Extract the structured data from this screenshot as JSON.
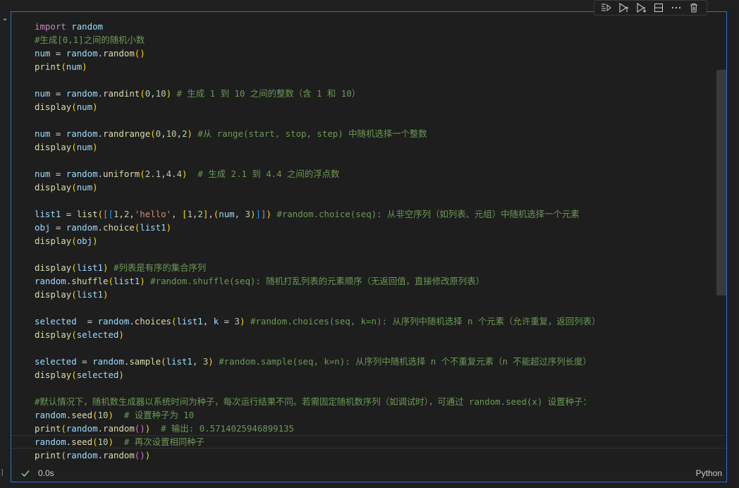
{
  "cell": {
    "language": "Python",
    "execution_time": "0.0s",
    "status": "success",
    "left_edge_glyph": "]",
    "code_lines": [
      [
        [
          "kw",
          "import"
        ],
        [
          "op",
          " "
        ],
        [
          "var",
          "random"
        ]
      ],
      [
        [
          "cmt",
          "#生成[0,1]之间的随机小数"
        ]
      ],
      [
        [
          "var",
          "num"
        ],
        [
          "op",
          " = "
        ],
        [
          "var",
          "random"
        ],
        [
          "op",
          "."
        ],
        [
          "fn",
          "random"
        ],
        [
          "p1",
          "()"
        ]
      ],
      [
        [
          "fn",
          "print"
        ],
        [
          "p1",
          "("
        ],
        [
          "var",
          "num"
        ],
        [
          "p1",
          ")"
        ]
      ],
      [],
      [
        [
          "var",
          "num"
        ],
        [
          "op",
          " = "
        ],
        [
          "var",
          "random"
        ],
        [
          "op",
          "."
        ],
        [
          "fn",
          "randint"
        ],
        [
          "p1",
          "("
        ],
        [
          "num",
          "0"
        ],
        [
          "op",
          ","
        ],
        [
          "num",
          "10"
        ],
        [
          "p1",
          ")"
        ],
        [
          "op",
          " "
        ],
        [
          "cmt",
          "# 生成 1 到 10 之间的整数（含 1 和 10）"
        ]
      ],
      [
        [
          "fn",
          "display"
        ],
        [
          "p1",
          "("
        ],
        [
          "var",
          "num"
        ],
        [
          "p1",
          ")"
        ]
      ],
      [],
      [
        [
          "var",
          "num"
        ],
        [
          "op",
          " = "
        ],
        [
          "var",
          "random"
        ],
        [
          "op",
          "."
        ],
        [
          "fn",
          "randrange"
        ],
        [
          "p1",
          "("
        ],
        [
          "num",
          "0"
        ],
        [
          "op",
          ","
        ],
        [
          "num",
          "10"
        ],
        [
          "op",
          ","
        ],
        [
          "num",
          "2"
        ],
        [
          "p1",
          ")"
        ],
        [
          "op",
          " "
        ],
        [
          "cmt",
          "#从 range(start, stop, step) 中随机选择一个整数"
        ]
      ],
      [
        [
          "fn",
          "display"
        ],
        [
          "p1",
          "("
        ],
        [
          "var",
          "num"
        ],
        [
          "p1",
          ")"
        ]
      ],
      [],
      [
        [
          "var",
          "num"
        ],
        [
          "op",
          " = "
        ],
        [
          "var",
          "random"
        ],
        [
          "op",
          "."
        ],
        [
          "fn",
          "uniform"
        ],
        [
          "p1",
          "("
        ],
        [
          "num",
          "2.1"
        ],
        [
          "op",
          ","
        ],
        [
          "num",
          "4.4"
        ],
        [
          "p1",
          ")"
        ],
        [
          "op",
          "  "
        ],
        [
          "cmt",
          "# 生成 2.1 到 4.4 之间的浮点数"
        ]
      ],
      [
        [
          "fn",
          "display"
        ],
        [
          "p1",
          "("
        ],
        [
          "var",
          "num"
        ],
        [
          "p1",
          ")"
        ]
      ],
      [],
      [
        [
          "var",
          "list1"
        ],
        [
          "op",
          " = "
        ],
        [
          "fn",
          "list"
        ],
        [
          "p1",
          "("
        ],
        [
          "p2",
          "["
        ],
        [
          "p3",
          "["
        ],
        [
          "num",
          "1"
        ],
        [
          "op",
          ","
        ],
        [
          "num",
          "2"
        ],
        [
          "op",
          ","
        ],
        [
          "str",
          "'hello'"
        ],
        [
          "op",
          ", "
        ],
        [
          "p1",
          "["
        ],
        [
          "num",
          "1"
        ],
        [
          "op",
          ","
        ],
        [
          "num",
          "2"
        ],
        [
          "p1",
          "]"
        ],
        [
          "op",
          ","
        ],
        [
          "p1",
          "("
        ],
        [
          "var",
          "num"
        ],
        [
          "op",
          ", "
        ],
        [
          "num",
          "3"
        ],
        [
          "p1",
          ")"
        ],
        [
          "p3",
          "]"
        ],
        [
          "p2",
          "]"
        ],
        [
          "p1",
          ")"
        ],
        [
          "op",
          " "
        ],
        [
          "cmt",
          "#random.choice(seq): 从非空序列（如列表、元组）中随机选择一个元素"
        ]
      ],
      [
        [
          "var",
          "obj"
        ],
        [
          "op",
          " = "
        ],
        [
          "var",
          "random"
        ],
        [
          "op",
          "."
        ],
        [
          "fn",
          "choice"
        ],
        [
          "p1",
          "("
        ],
        [
          "var",
          "list1"
        ],
        [
          "p1",
          ")"
        ]
      ],
      [
        [
          "fn",
          "display"
        ],
        [
          "p1",
          "("
        ],
        [
          "var",
          "obj"
        ],
        [
          "p1",
          ")"
        ]
      ],
      [],
      [
        [
          "fn",
          "display"
        ],
        [
          "p1",
          "("
        ],
        [
          "var",
          "list1"
        ],
        [
          "p1",
          ")"
        ],
        [
          "op",
          " "
        ],
        [
          "cmt",
          "#列表是有序的集合序列"
        ]
      ],
      [
        [
          "var",
          "random"
        ],
        [
          "op",
          "."
        ],
        [
          "fn",
          "shuffle"
        ],
        [
          "p1",
          "("
        ],
        [
          "var",
          "list1"
        ],
        [
          "p1",
          ")"
        ],
        [
          "op",
          " "
        ],
        [
          "cmt",
          "#random.shuffle(seq): 随机打乱列表的元素顺序（无返回值，直接修改原列表）"
        ]
      ],
      [
        [
          "fn",
          "display"
        ],
        [
          "p1",
          "("
        ],
        [
          "var",
          "list1"
        ],
        [
          "p1",
          ")"
        ]
      ],
      [],
      [
        [
          "var",
          "selected"
        ],
        [
          "op",
          "  = "
        ],
        [
          "var",
          "random"
        ],
        [
          "op",
          "."
        ],
        [
          "fn",
          "choices"
        ],
        [
          "p1",
          "("
        ],
        [
          "var",
          "list1"
        ],
        [
          "op",
          ", "
        ],
        [
          "var",
          "k"
        ],
        [
          "op",
          " = "
        ],
        [
          "num",
          "3"
        ],
        [
          "p1",
          ")"
        ],
        [
          "op",
          " "
        ],
        [
          "cmt",
          "#random.choices(seq, k=n): 从序列中随机选择 n 个元素（允许重复，返回列表）"
        ]
      ],
      [
        [
          "fn",
          "display"
        ],
        [
          "p1",
          "("
        ],
        [
          "var",
          "selected"
        ],
        [
          "p1",
          ")"
        ]
      ],
      [],
      [
        [
          "var",
          "selected"
        ],
        [
          "op",
          " = "
        ],
        [
          "var",
          "random"
        ],
        [
          "op",
          "."
        ],
        [
          "fn",
          "sample"
        ],
        [
          "p1",
          "("
        ],
        [
          "var",
          "list1"
        ],
        [
          "op",
          ", "
        ],
        [
          "num",
          "3"
        ],
        [
          "p1",
          ")"
        ],
        [
          "op",
          " "
        ],
        [
          "cmt",
          "#random.sample(seq, k=n): 从序列中随机选择 n 个不重复元素（n 不能超过序列长度）"
        ]
      ],
      [
        [
          "fn",
          "display"
        ],
        [
          "p1",
          "("
        ],
        [
          "var",
          "selected"
        ],
        [
          "p1",
          ")"
        ]
      ],
      [],
      [
        [
          "cmt",
          "#默认情况下，随机数生成器以系统时间为种子，每次运行结果不同。若需固定随机数序列（如调试时），可通过 random.seed(x) 设置种子："
        ]
      ],
      [
        [
          "var",
          "random"
        ],
        [
          "op",
          "."
        ],
        [
          "fn",
          "seed"
        ],
        [
          "p1",
          "("
        ],
        [
          "num",
          "10"
        ],
        [
          "p1",
          ")"
        ],
        [
          "op",
          "  "
        ],
        [
          "cmt",
          "# 设置种子为 10"
        ]
      ],
      [
        [
          "fn",
          "print"
        ],
        [
          "p1",
          "("
        ],
        [
          "var",
          "random"
        ],
        [
          "op",
          "."
        ],
        [
          "fn",
          "random"
        ],
        [
          "p2",
          "()"
        ],
        [
          "p1",
          ")"
        ],
        [
          "op",
          "  "
        ],
        [
          "cmt",
          "# 输出: 0.5714025946899135"
        ]
      ],
      [
        [
          "var",
          "random"
        ],
        [
          "op",
          "."
        ],
        [
          "fn",
          "seed"
        ],
        [
          "p1",
          "("
        ],
        [
          "num",
          "10"
        ],
        [
          "p1",
          ")"
        ],
        [
          "op",
          "  "
        ],
        [
          "cmt",
          "# 再次设置相同种子"
        ]
      ],
      [
        [
          "fn",
          "print"
        ],
        [
          "p1",
          "("
        ],
        [
          "var",
          "random"
        ],
        [
          "op",
          "."
        ],
        [
          "fn",
          "random"
        ],
        [
          "p2",
          "()"
        ],
        [
          "p1",
          ")"
        ]
      ]
    ],
    "current_line_index": 31
  },
  "toolbar": {
    "buttons": [
      {
        "name": "run-by-line-icon"
      },
      {
        "name": "execute-above-icon"
      },
      {
        "name": "execute-cell-and-below-icon"
      },
      {
        "name": "split-cell-icon"
      },
      {
        "name": "more-actions-icon"
      },
      {
        "name": "delete-cell-icon"
      }
    ]
  },
  "colors": {
    "accent_border": "#2a6ed6",
    "success_check": "#89d185"
  }
}
